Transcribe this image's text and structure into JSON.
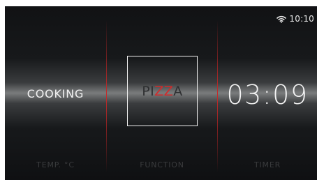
{
  "status": {
    "time": "10:10",
    "wifi_icon": "wifi-icon"
  },
  "main": {
    "mode": "COOKING",
    "function": {
      "parts": [
        "PI",
        "ZZ",
        "A"
      ],
      "colors": [
        "#2e2f31",
        "#d42a2a",
        "#2e2f31"
      ]
    },
    "timer": "03:09"
  },
  "footer": {
    "temp_label": "TEMP. °C",
    "function_label": "FUNCTION",
    "timer_label": "TIMER"
  },
  "colors": {
    "accent": "#d42a2a",
    "divider": "#c82828",
    "text": "#f2f2f2",
    "muted_label": "#3a3b3d"
  }
}
